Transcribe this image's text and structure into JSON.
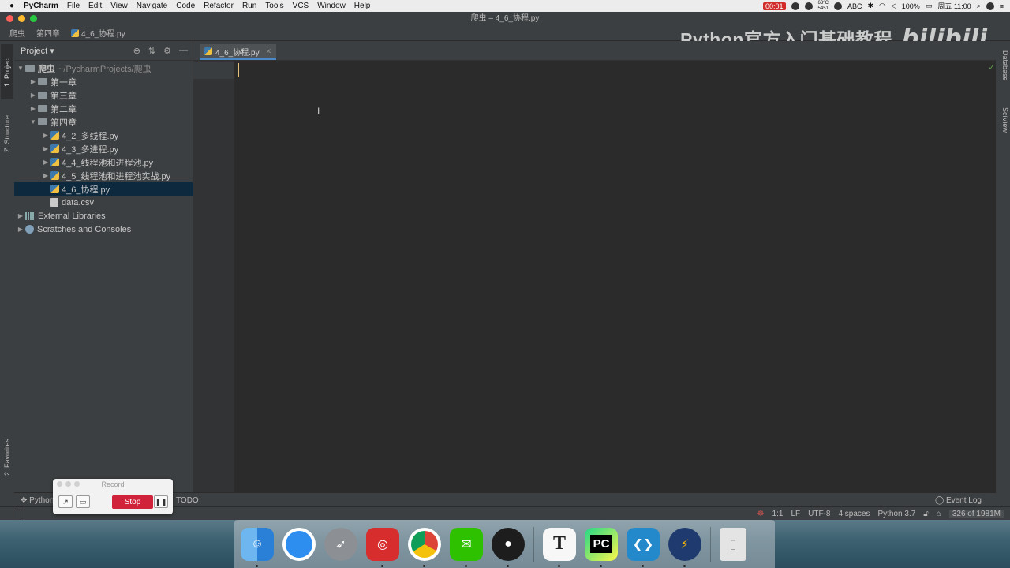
{
  "menubar": {
    "app_name": "PyCharm",
    "items": [
      "File",
      "Edit",
      "View",
      "Navigate",
      "Code",
      "Refactor",
      "Run",
      "Tools",
      "VCS",
      "Window",
      "Help"
    ],
    "rec_time": "00:01",
    "temp": "63°C",
    "fan": "5451",
    "input_method": "ABC",
    "battery": "100%",
    "clock": "周五 11:00"
  },
  "window": {
    "title": "爬虫 – 4_6_协程.py"
  },
  "breadcrumb": [
    "爬虫",
    "第四章",
    "4_6_协程.py"
  ],
  "watermark": {
    "text": "Python官方入门基础教程",
    "logo": "bilibili"
  },
  "left_strip": {
    "project_tab": "1: Project",
    "structure_tab": "Z: Structure",
    "favorites_tab": "2: Favorites"
  },
  "right_strip": {
    "database_tab": "Database",
    "sciview_tab": "SciView"
  },
  "project_panel": {
    "title": "Project",
    "root_name": "爬虫",
    "root_path": "~/PycharmProjects/爬虫",
    "folders": [
      "第一章",
      "第三章",
      "第二章",
      "第四章"
    ],
    "files": [
      "4_2_多线程.py",
      "4_3_多进程.py",
      "4_4_线程池和进程池.py",
      "4_5_线程池和进程池实战.py",
      "4_6_协程.py",
      "data.csv"
    ],
    "external_libraries": "External Libraries",
    "scratches": "Scratches and Consoles"
  },
  "editor": {
    "tab_label": "4_6_协程.py"
  },
  "bottom_bar": {
    "python_tab": "Python",
    "todo_tab": "TODO",
    "event_log": "Event Log"
  },
  "status": {
    "position": "1:1",
    "line_sep": "LF",
    "encoding": "UTF-8",
    "indent": "4 spaces",
    "interpreter": "Python 3.7",
    "memory": "326 of 1981M"
  },
  "record_widget": {
    "title": "Record",
    "stop_label": "Stop"
  },
  "dock": {
    "apps": [
      "finder-icon",
      "safari-icon",
      "launchpad-icon",
      "netease-music-icon",
      "chrome-icon",
      "wechat-icon",
      "qq-icon",
      "typora-icon",
      "pycharm-icon",
      "vscode-icon",
      "instastats-icon",
      "trash-icon"
    ],
    "pycharm_label": "PC",
    "typora_label": "T"
  },
  "colors": {
    "accent": "#4a88c7",
    "selection": "#0d293e",
    "caret": "#e6c07b",
    "stop": "#d0223b"
  }
}
